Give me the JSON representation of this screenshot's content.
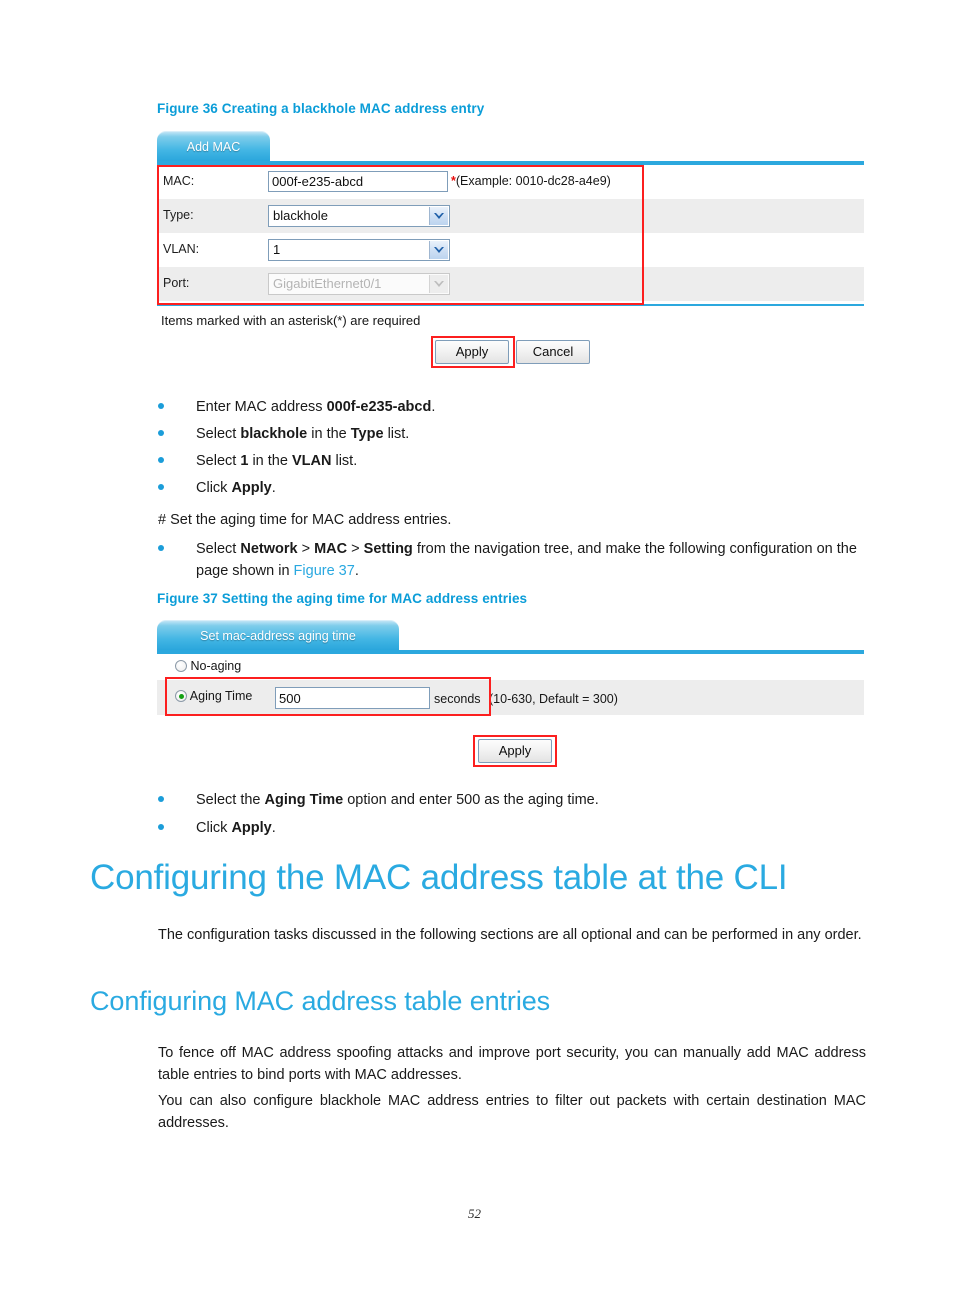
{
  "page": {
    "number": "52"
  },
  "figure36": {
    "caption": "Figure 36 Creating a blackhole MAC address entry",
    "tab_label": "Add MAC",
    "rows": [
      {
        "label": "MAC:",
        "value": "000f-e235-abcd",
        "kind": "input",
        "hint_star": "*",
        "hint": "(Example: 0010-dc28-a4e9)"
      },
      {
        "label": "Type:",
        "value": "blackhole",
        "kind": "select"
      },
      {
        "label": "VLAN:",
        "value": "1",
        "kind": "select"
      },
      {
        "label": "Port:",
        "value": "GigabitEthernet0/1",
        "kind": "select-disabled"
      }
    ],
    "required_note": "Items marked with an asterisk(*) are required",
    "apply_label": "Apply",
    "cancel_label": "Cancel",
    "highlight_color": "#fc1f1f"
  },
  "steps1": [
    {
      "pre": "Enter MAC address ",
      "bold": "000f-e235-abcd",
      "post": "."
    },
    {
      "pre": "Select ",
      "bold": "blackhole",
      "mid": " in the ",
      "bold2": "Type",
      "post": " list."
    },
    {
      "pre": "Select ",
      "bold": "1",
      "mid": " in the ",
      "bold2": "VLAN",
      "post": " list."
    },
    {
      "pre": "Click ",
      "bold": "Apply",
      "post": "."
    }
  ],
  "comment1": "# Set the aging time for MAC address entries.",
  "step_nav": {
    "pre": "Select ",
    "b1": "Network",
    "sep1": " > ",
    "b2": "MAC",
    "sep2": " > ",
    "b3": "Setting",
    "post": " from the navigation tree, and make the following configuration on the page shown in ",
    "link": "Figure 37",
    "tail": "."
  },
  "figure37": {
    "caption": "Figure 37 Setting the aging time for MAC address entries",
    "tab_label": "Set mac-address aging time",
    "option_no_aging": "No-aging",
    "option_aging_time": "Aging Time",
    "aging_value": "500",
    "unit": "seconds",
    "range_hint": "(10-630, Default = 300)",
    "apply_label": "Apply",
    "selected_option": "aging-time"
  },
  "steps2": [
    {
      "pre": "Select the ",
      "bold": "Aging Time",
      "post": " option and enter 500 as the aging time."
    },
    {
      "pre": "Click ",
      "bold": "Apply",
      "post": "."
    }
  ],
  "section1": {
    "heading": "Configuring the MAC address table at the CLI",
    "body": "The configuration tasks discussed in the following sections are all optional and can be performed in any order."
  },
  "section2": {
    "heading": "Configuring MAC address table entries",
    "body1": "To fence off MAC address spoofing attacks and improve port security, you can manually add MAC address table entries to bind ports with MAC addresses.",
    "body2": "You can also configure blackhole MAC address entries to filter out packets with certain destination MAC addresses."
  }
}
